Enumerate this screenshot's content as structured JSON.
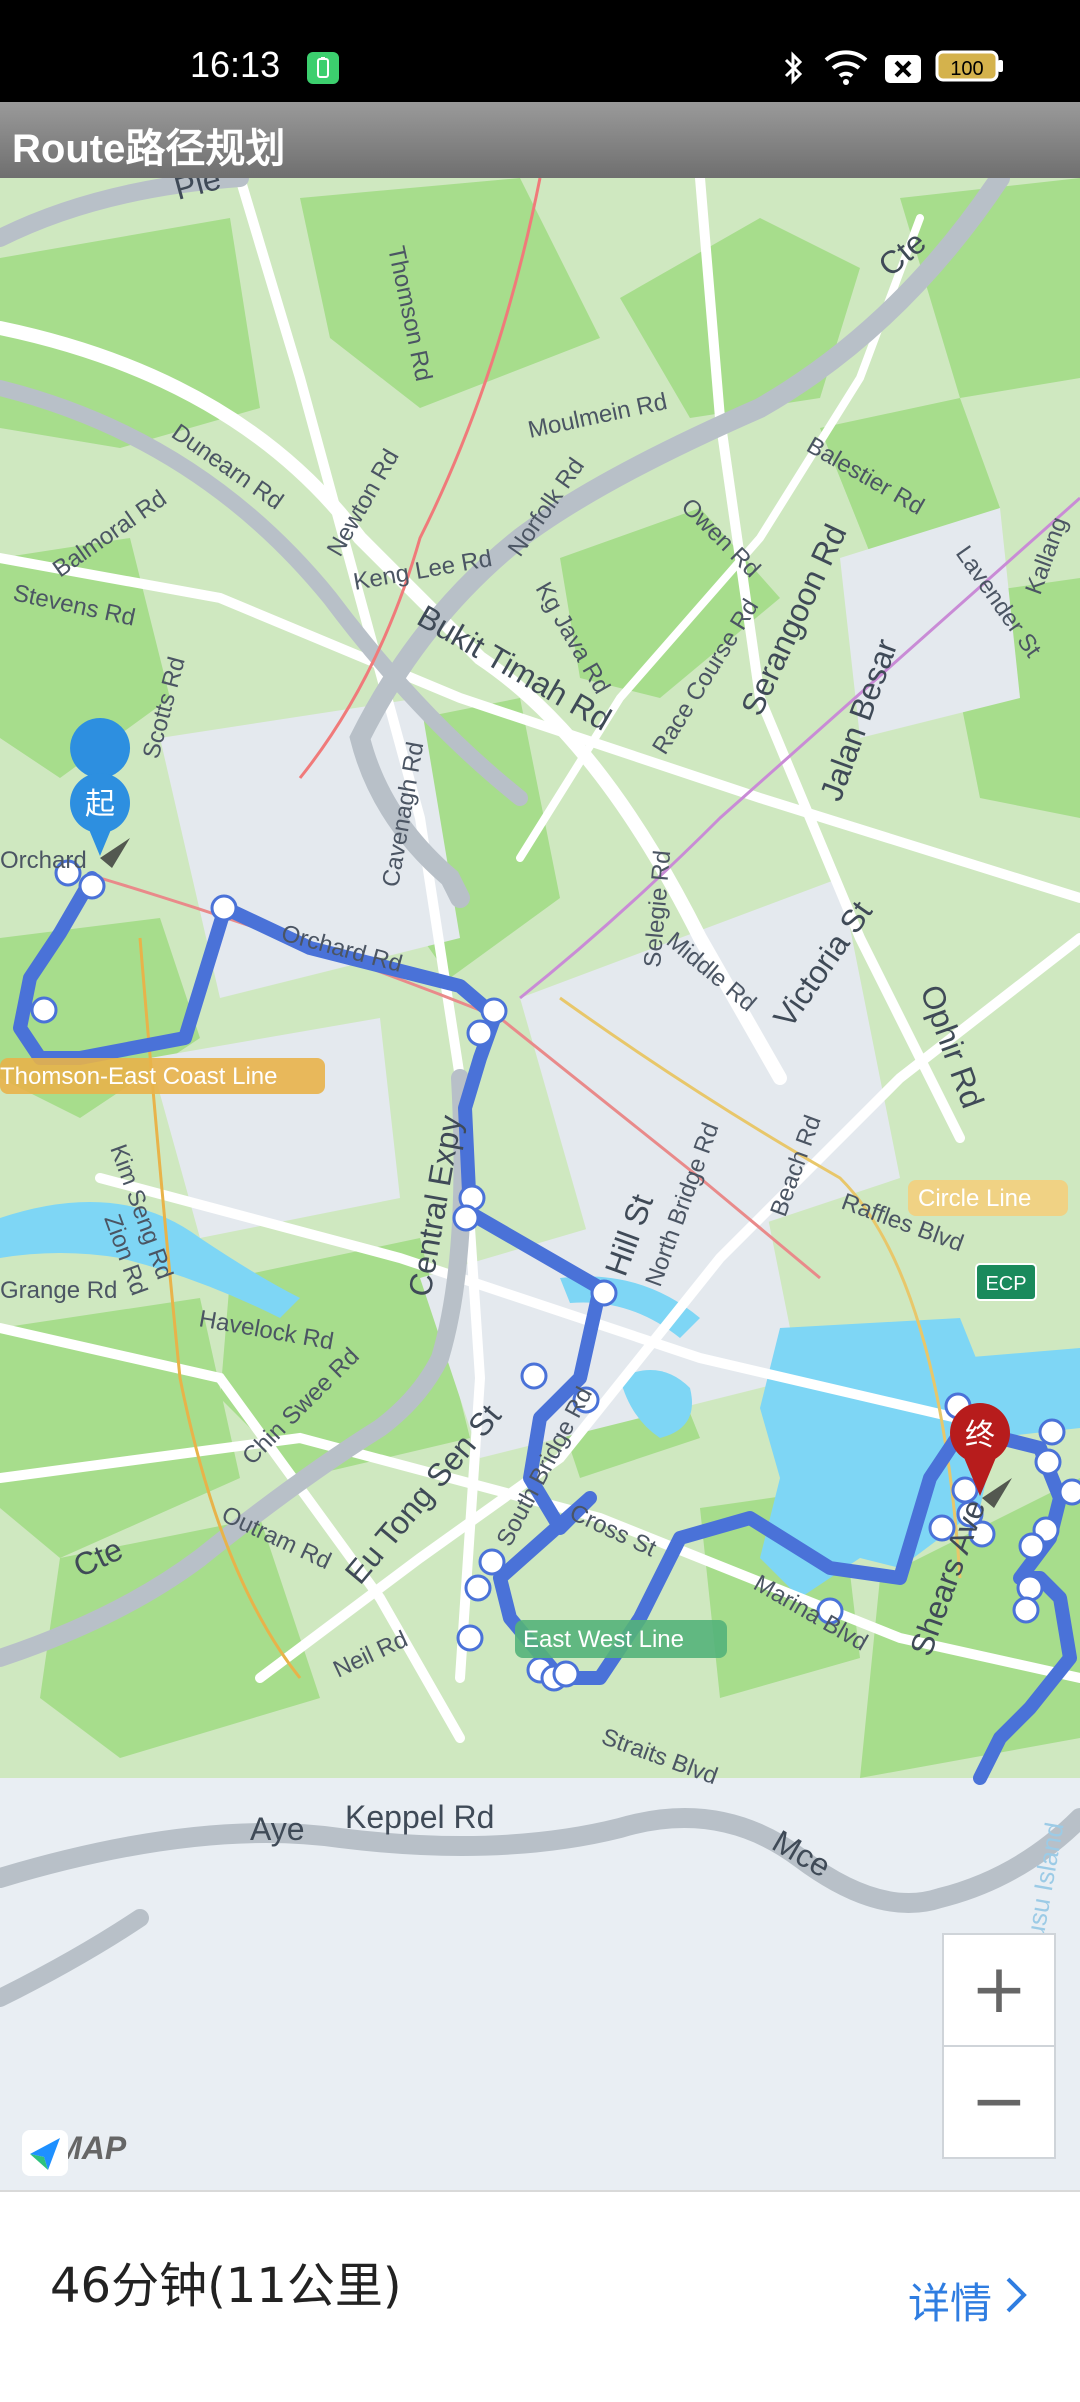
{
  "status_bar": {
    "time": "16:13",
    "battery": "100"
  },
  "app_bar": {
    "title": "Route路径规划"
  },
  "map": {
    "start_marker": "起",
    "end_marker": "终",
    "road_labels": [
      "Dunearn Rd",
      "Thomson Rd",
      "Moulmein Rd",
      "Balestier Rd",
      "Newton Rd",
      "Norfolk Rd",
      "Keng Lee Rd",
      "Owen Rd",
      "Bukit Timah Rd",
      "Kg Java Rd",
      "Race Course Rd",
      "Serangoon Rd",
      "Jalan Besar",
      "Lavender St",
      "Balmoral Rd",
      "Stevens Rd",
      "Scotts Rd",
      "Cavenagh Rd",
      "Orchard Rd",
      "Selegie Rd",
      "Middle Rd",
      "Victoria St",
      "Ophir Rd",
      "Central Expy",
      "North Bridge Rd",
      "Beach Rd",
      "Raffles Blvd",
      "Hill St",
      "Kim Seng Rd",
      "Zion Rd",
      "Havelock Rd",
      "Chin Swee Rd",
      "Outram Rd",
      "Eu Tong Sen St",
      "South Bridge Rd",
      "Cross St",
      "Marina Blvd",
      "Shears Ave",
      "Neil Rd",
      "Straits Blvd",
      "Aye",
      "Keppel Rd",
      "Mce",
      "Cte",
      "Pie",
      "Kallang",
      "Grange Rd",
      "Orchard"
    ],
    "line_labels": [
      "Thomson-East Coast Line",
      "Circle Line",
      "East West Line"
    ],
    "highway_shield": "ECP",
    "water_label": "Kusu Island",
    "zoom_in": "+",
    "zoom_out": "−",
    "logo_text": "AMAP"
  },
  "summary": {
    "duration_distance": "46分钟(11公里)",
    "details_label": "详情"
  },
  "colors": {
    "route": "#4a72d8",
    "park": "#a7dd8c",
    "water": "#7ed6f5",
    "map_bg": "#e9eef3",
    "accent": "#2f7de1"
  }
}
